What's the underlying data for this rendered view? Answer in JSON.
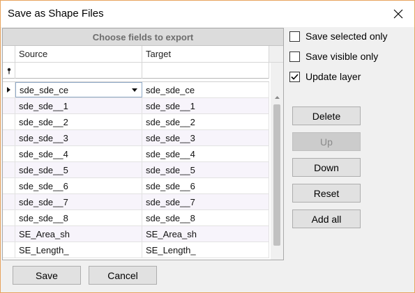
{
  "window": {
    "title": "Save as Shape Files"
  },
  "grid": {
    "group_header": "Choose fields to export",
    "columns": {
      "source": "Source",
      "target": "Target"
    },
    "rows": [
      {
        "source": "sde_sde_ce",
        "target": "sde_sde_ce"
      },
      {
        "source": "sde_sde__1",
        "target": "sde_sde__1"
      },
      {
        "source": "sde_sde__2",
        "target": "sde_sde__2"
      },
      {
        "source": "sde_sde__3",
        "target": "sde_sde__3"
      },
      {
        "source": "sde_sde__4",
        "target": "sde_sde__4"
      },
      {
        "source": "sde_sde__5",
        "target": "sde_sde__5"
      },
      {
        "source": "sde_sde__6",
        "target": "sde_sde__6"
      },
      {
        "source": "sde_sde__7",
        "target": "sde_sde__7"
      },
      {
        "source": "sde_sde__8",
        "target": "sde_sde__8"
      },
      {
        "source": "SE_Area_sh",
        "target": "SE_Area_sh"
      },
      {
        "source": "SE_Length_",
        "target": "SE_Length_"
      }
    ]
  },
  "options": {
    "save_selected_only": {
      "label": "Save selected only",
      "checked": false
    },
    "save_visible_only": {
      "label": "Save visible only",
      "checked": false
    },
    "update_layer": {
      "label": "Update layer",
      "checked": true
    }
  },
  "buttons": {
    "delete": "Delete",
    "up": "Up",
    "down": "Down",
    "reset": "Reset",
    "add_all": "Add all",
    "save": "Save",
    "cancel": "Cancel"
  }
}
